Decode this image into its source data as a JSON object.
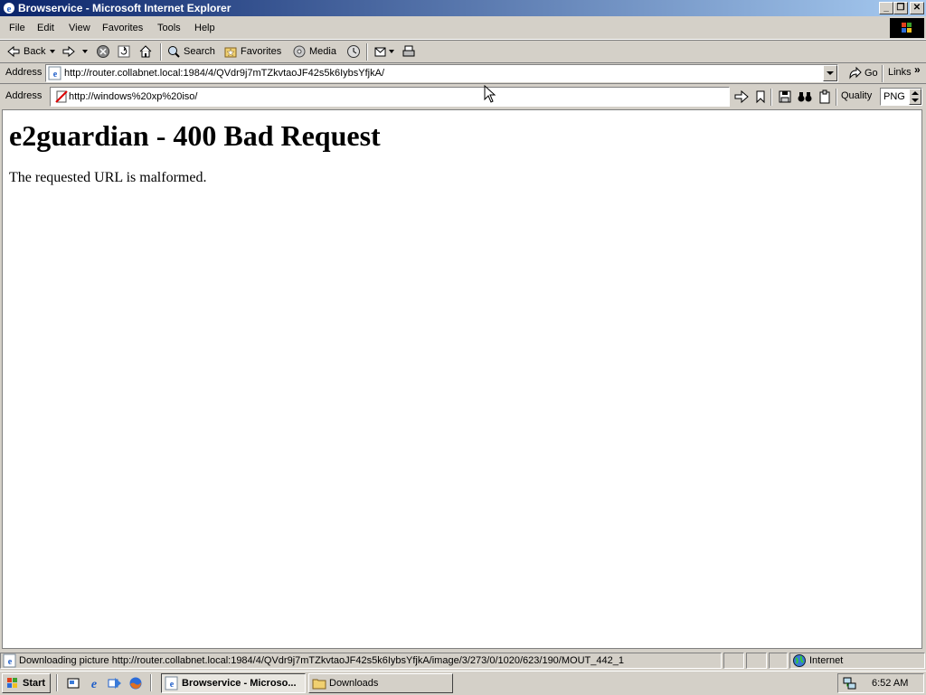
{
  "window": {
    "title": "Browservice - Microsoft Internet Explorer",
    "icon": "ie-icon",
    "buttons": [
      "minimize",
      "restore",
      "close"
    ]
  },
  "menubar": {
    "items": [
      {
        "label": "File"
      },
      {
        "label": "Edit"
      },
      {
        "label": "View"
      },
      {
        "label": "Favorites"
      },
      {
        "label": "Tools"
      },
      {
        "label": "Help"
      }
    ]
  },
  "toolbar": {
    "back_label": "Back",
    "search_label": "Search",
    "favorites_label": "Favorites",
    "media_label": "Media"
  },
  "addressbar": {
    "label": "Address",
    "url": "http://router.collabnet.local:1984/4/QVdr9j7mTZkvtaoJF42s5k6IybsYfjkA/",
    "go_label": "Go",
    "links_label": "Links"
  },
  "browservice_bar": {
    "label": "Address",
    "url": "http://windows%20xp%20iso/",
    "quality_label": "Quality",
    "quality_value": "PNG"
  },
  "page": {
    "heading": "e2guardian - 400 Bad Request",
    "message": "The requested URL is malformed."
  },
  "statusbar": {
    "text": "Downloading picture http://router.collabnet.local:1984/4/QVdr9j7mTZkvtaoJF42s5k6IybsYfjkA/image/3/273/0/1020/623/190/MOUT_442_1",
    "zone": "Internet"
  },
  "taskbar": {
    "start_label": "Start",
    "tasks": [
      {
        "label": "Browservice - Microso...",
        "active": true
      },
      {
        "label": "Downloads",
        "active": false
      }
    ],
    "clock": "6:52 AM"
  }
}
